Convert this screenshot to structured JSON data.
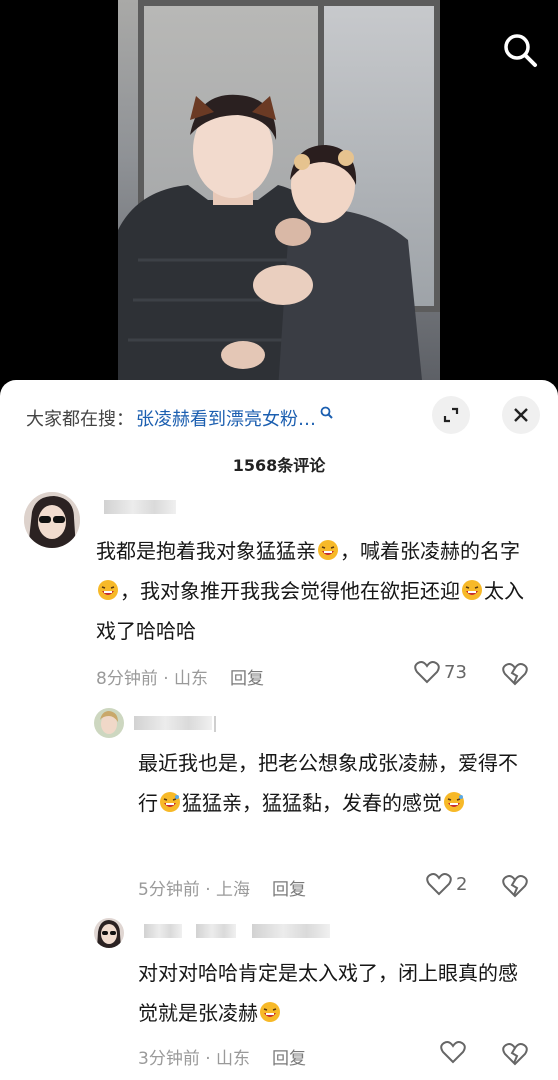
{
  "search_bar": {
    "prefix": "大家都在搜：",
    "query": "张凌赫看到漂亮女粉…"
  },
  "comment_count": "1568条评论",
  "comments": [
    {
      "text_parts": [
        "我都是抱着我对象猛猛亲",
        "，喊着张凌赫的名字",
        "，我对象推开我我会觉得他在欲拒还迎",
        "太入戏了哈哈哈"
      ],
      "time_location": "8分钟前 · 山东",
      "reply_label": "回复",
      "likes": "73"
    },
    {
      "text_parts": [
        "最近我也是，把老公想象成张凌赫，爱得不行",
        "猛猛亲，猛猛黏，发春的感觉",
        ""
      ],
      "time_location": "5分钟前 · 上海",
      "reply_label": "回复",
      "likes": "2"
    },
    {
      "text_parts": [
        "对对对哈哈肯定是太入戏了，闭上眼真的感觉就是张凌赫",
        ""
      ],
      "time_location": "3分钟前 · 山东",
      "reply_label": "回复",
      "likes": ""
    }
  ],
  "colors": {
    "link_blue": "#1c5fb0",
    "meta_gray": "#9a9a9a",
    "sheet_bg": "#ffffff",
    "emoji_yellow": "#f7b928"
  },
  "icons": {
    "video_search": "search-icon",
    "expand": "expand-icon",
    "close": "close-icon",
    "search_suffix": "search-icon",
    "like": "heart-icon",
    "dislike": "broken-heart-icon",
    "emoji": "laughing-emoji-icon"
  }
}
